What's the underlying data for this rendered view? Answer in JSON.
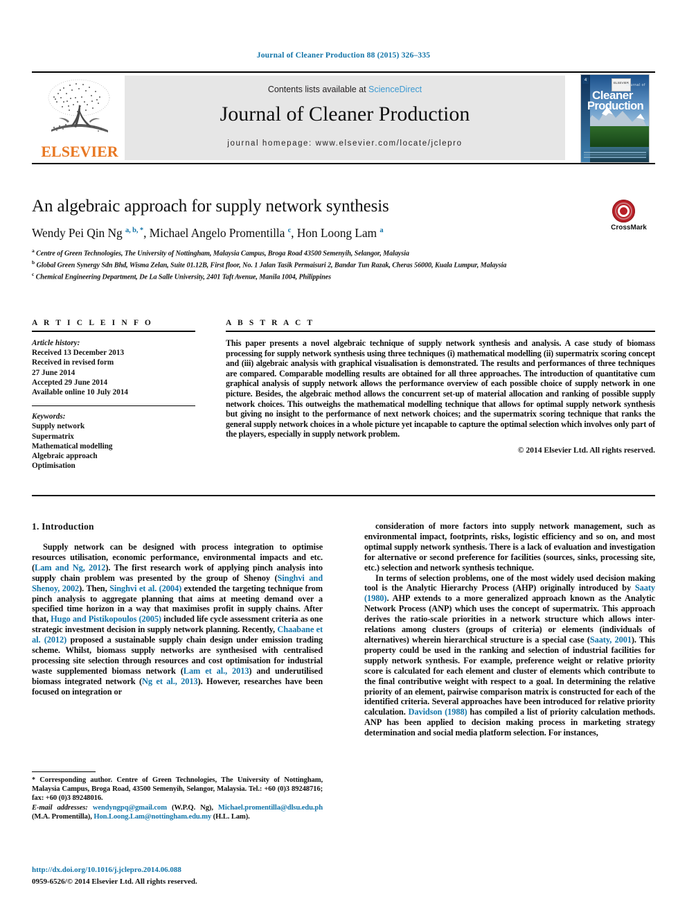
{
  "running_head": "Journal of Cleaner Production 88 (2015) 326–335",
  "masthead": {
    "contents_prefix": "Contents lists available at ",
    "sciencedirect": "ScienceDirect",
    "journal_title": "Journal of Cleaner Production",
    "homepage": "journal homepage: www.elsevier.com/locate/jclepro",
    "publisher": "ELSEVIER",
    "publisher_color": "#E87722",
    "sciencedirect_color": "#3d9ad2",
    "cover": {
      "line1": "Journal of",
      "line2": "Cleaner",
      "line3": "Production",
      "badge": "4",
      "imprint": "ELSEVIER"
    }
  },
  "article": {
    "title": "An algebraic approach for supply network synthesis",
    "authors_html": "Wendy Pei Qin Ng <sup>a, b, *</sup>, Michael Angelo Promentilla <sup>c</sup>, Hon Loong Lam <sup>a</sup>",
    "affiliations": [
      "<sup>a</sup> Centre of Green Technologies, The University of Nottingham, Malaysia Campus, Broga Road 43500 Semenyih, Selangor, Malaysia",
      "<sup>b</sup> Global Green Synergy Sdn Bhd, Wisma Zelan, Suite 01.12B, First floor, No. 1 Jalan Tasik Permaisuri 2, Bandar Tun Razak, Cheras 56000, Kuala Lumpur, Malaysia",
      "<sup>c</sup> Chemical Engineering Department, De La Salle University, 2401 Taft Avenue, Manila 1004, Philippines"
    ],
    "crossmark_label": "CrossMark",
    "crossmark_color": "#b81f27"
  },
  "info": {
    "article_info_heading": "A R T I C L E  I N F O",
    "abstract_heading": "A B S T R A C T",
    "history_label": "Article history:",
    "history": [
      "Received 13 December 2013",
      "Received in revised form",
      "27 June 2014",
      "Accepted 29 June 2014",
      "Available online 10 July 2014"
    ],
    "keywords_label": "Keywords:",
    "keywords": [
      "Supply network",
      "Supermatrix",
      "Mathematical modelling",
      "Algebraic approach",
      "Optimisation"
    ],
    "abstract": "This paper presents a novel algebraic technique of supply network synthesis and analysis. A case study of biomass processing for supply network synthesis using three techniques (i) mathematical modelling (ii) supermatrix scoring concept and (iii) algebraic analysis with graphical visualisation is demonstrated. The results and performances of three techniques are compared. Comparable modelling results are obtained for all three approaches. The introduction of quantitative cum graphical analysis of supply network allows the performance overview of each possible choice of supply network in one picture. Besides, the algebraic method allows the concurrent set-up of material allocation and ranking of possible supply network choices. This outweighs the mathematical modelling technique that allows for optimal supply network synthesis but giving no insight to the performance of next network choices; and the supermatrix scoring technique that ranks the general supply network choices in a whole picture yet incapable to capture the optimal selection which involves only part of the players, especially in supply network problem.",
    "copyright": "© 2014 Elsevier Ltd. All rights reserved."
  },
  "body": {
    "section_heading": "1. Introduction",
    "left_paragraphs_html": [
      "Supply network can be designed with process integration to optimise resources utilisation, economic performance, environmental impacts and etc. (<span class=\"cite\">Lam and Ng, 2012</span>). The first research work of applying pinch analysis into supply chain problem was presented by the group of Shenoy (<span class=\"cite\">Singhvi and Shenoy, 2002</span>). Then, <span class=\"cite\">Singhvi et al. (2004)</span> extended the targeting technique from pinch analysis to aggregate planning that aims at meeting demand over a specified time horizon in a way that maximises profit in supply chains. After that, <span class=\"cite\">Hugo and Pistikopoulos (2005)</span> included life cycle assessment criteria as one strategic investment decision in supply network planning. Recently, <span class=\"cite\">Chaabane et al. (2012)</span> proposed a sustainable supply chain design under emission trading scheme. Whilst, biomass supply networks are synthesised with centralised processing site selection through resources and cost optimisation for industrial waste supplemented biomass network (<span class=\"cite\">Lam et al., 2013</span>) and underutilised biomass integrated network (<span class=\"cite\">Ng et al., 2013</span>). However, researches have been focused on integration or"
    ],
    "right_paragraphs_html": [
      "consideration of more factors into supply network management, such as environmental impact, footprints, risks, logistic efficiency and so on, and most optimal supply network synthesis. There is a lack of evaluation and investigation for alternative or second preference for facilities (sources, sinks, processing site, etc.) selection and network synthesis technique.",
      "In terms of selection problems, one of the most widely used decision making tool is the Analytic Hierarchy Process (AHP) originally introduced by <span class=\"cite\">Saaty (1980)</span>. AHP extends to a more generalized approach known as the Analytic Network Process (ANP) which uses the concept of supermatrix. This approach derives the ratio-scale priorities in a network structure which allows inter-relations among clusters (groups of criteria) or elements (individuals of alternatives) wherein hierarchical structure is a special case (<span class=\"cite\">Saaty, 2001</span>). This property could be used in the ranking and selection of industrial facilities for supply network synthesis. For example, preference weight or relative priority score is calculated for each element and cluster of elements which contribute to the final contributive weight with respect to a goal. In determining the relative priority of an element, pairwise comparison matrix is constructed for each of the identified criteria. Several approaches have been introduced for relative priority calculation. <span class=\"cite\">Davidson (1988)</span> has compiled a list of priority calculation methods. ANP has been applied to decision making process in marketing strategy determination and social media platform selection. For instances,"
    ]
  },
  "footnotes": {
    "corresponding_html": "<span class=\"star\">*</span> Corresponding author. Centre of Green Technologies, The University of Nottingham, Malaysia Campus, Broga Road, 43500 Semenyih, Selangor, Malaysia. Tel.: +60 (0)3 89248716; fax: +60 (0)3 89248016.",
    "email_html": "<span class=\"lbl\">E-mail addresses:</span> <span class=\"link\">wendyngpq@gmail.com</span> (W.P.Q. Ng), <span class=\"link\">Michael.promentilla@dlsu.edu.ph</span> (M.A. Promentilla), <span class=\"link\">Hon.Loong.Lam@nottingham.edu.my</span> (H.L. Lam).",
    "doi": "http://dx.doi.org/10.1016/j.jclepro.2014.06.088",
    "issn": "0959-6526/© 2014 Elsevier Ltd. All rights reserved."
  }
}
